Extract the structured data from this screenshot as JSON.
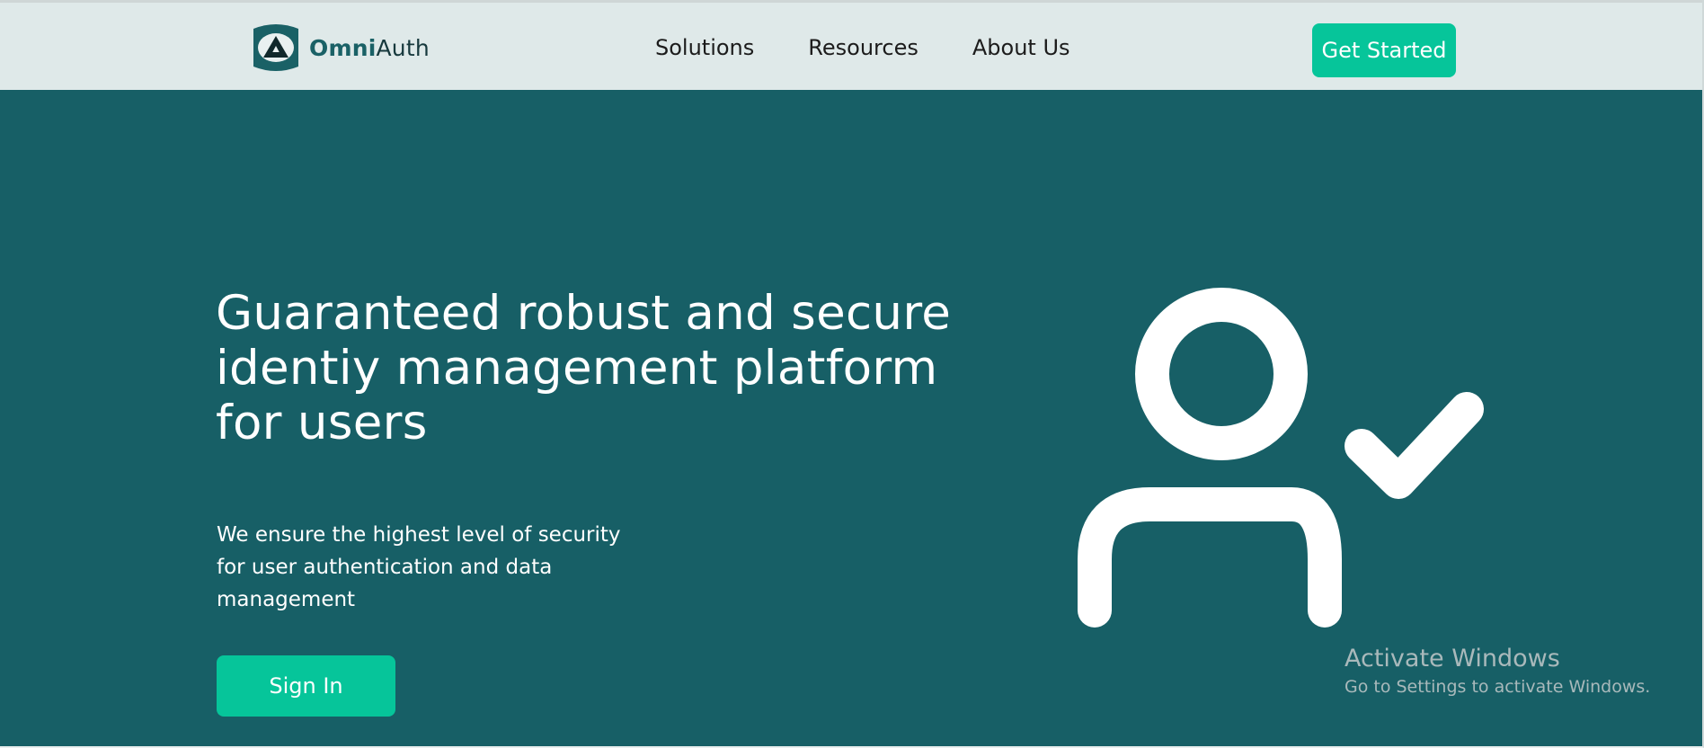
{
  "brand": {
    "name_bold": "Omni",
    "name_regular": "Auth",
    "logo_icon": "omniauth-logo-icon",
    "accent_color": "#06c59a",
    "primary_color": "#175f66"
  },
  "nav": {
    "links": [
      {
        "label": "Solutions"
      },
      {
        "label": "Resources"
      },
      {
        "label": "About Us"
      }
    ],
    "cta_label": "Get Started"
  },
  "hero": {
    "headline": "Guaranteed robust and secure identiy management platform for users",
    "subtext": "We ensure the highest level of security for user authentication and data management",
    "signin_label": "Sign In",
    "illustration_icon": "user-check-icon"
  },
  "watermark": {
    "title": "Activate Windows",
    "subtitle": "Go to Settings to activate Windows."
  }
}
